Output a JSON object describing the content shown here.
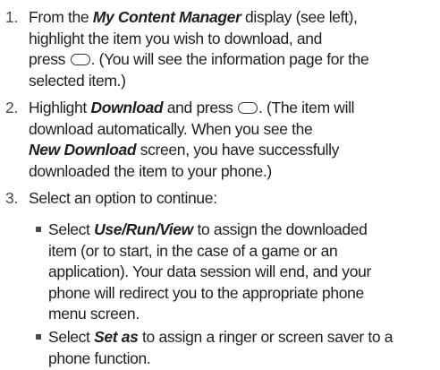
{
  "steps": [
    {
      "number": "1.",
      "lines": [
        {
          "a": "From the ",
          "b": "My Content Manager",
          "c": " display (see left),"
        },
        {
          "a": "highlight the item you wish to download, and"
        },
        {
          "a": "press ",
          "key": "ok-key",
          "c": ". (You will see the information page for the"
        },
        {
          "a": "selected item.)"
        }
      ]
    },
    {
      "number": "2.",
      "lines": [
        {
          "b": "Download",
          "c": " and press ",
          "pre": "Highlight ",
          "key": "ok-key",
          "d": ". (The item will"
        },
        {
          "a": "download automatically. When you see the"
        },
        {
          "b": "New Download",
          "c": " screen, you have successfully"
        },
        {
          "a": "downloaded the item to your phone.)"
        }
      ]
    },
    {
      "number": "3.",
      "lines": [
        {
          "a": "Select an option to continue:"
        }
      ]
    }
  ],
  "bullets": [
    {
      "lines": [
        {
          "a": "Select ",
          "b": "Use/Run/View",
          "c": " to assign the downloaded"
        },
        {
          "a": "item (or to start, in the case of a game or an"
        },
        {
          "a": "application). Your data session will end, and your"
        },
        {
          "a": "phone will redirect you to the appropriate phone"
        },
        {
          "a": "menu screen."
        }
      ]
    },
    {
      "lines": [
        {
          "a": "Select ",
          "b": "Set as",
          "c": " to assign a ringer or screen saver to a"
        },
        {
          "a": "phone function."
        }
      ]
    }
  ]
}
